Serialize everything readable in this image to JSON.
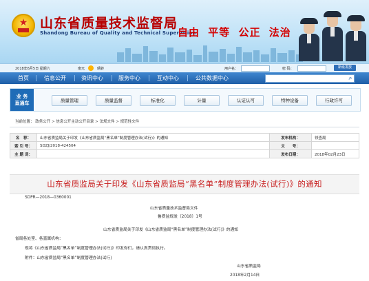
{
  "header": {
    "title": "山东省质量技术监督局",
    "subtitle": "Shandong Bureau of Quality and Technical Supervision",
    "slogan": [
      "自由",
      "平等",
      "公正",
      "法治"
    ]
  },
  "login_bar": {
    "date": "2018年6月5日 星期六",
    "weather_city": "南元",
    "weather": "晴转",
    "username_label": "用户名：",
    "password_label": "密 码：",
    "register_label": "新级发放"
  },
  "nav": {
    "items": [
      "首页",
      "信息公开",
      "资讯中心",
      "服务中心",
      "互动中心",
      "公共数据中心"
    ],
    "search_placeholder": ""
  },
  "business": {
    "label": "业务直通车",
    "buttons": [
      "质量管理",
      "质量监督",
      "标准化",
      "计量",
      "认证认可",
      "特种设备",
      "行政许可"
    ]
  },
  "breadcrumb": "当前位置：  政务公开  >  信息公开主动公开目录  >  法规文件  >  规范性文件",
  "meta": {
    "name_label": "名　称：",
    "name_value": "山东省质监局关于印发《山东省质监局“黑名单”制度管理办法(试行)》的通知",
    "issuer_label": "发布机构：",
    "issuer_value": "领查局",
    "index_label": "索 引 号：",
    "index_value": "SDZJ/2018-424504",
    "docno_label": "文　　号：",
    "docno_value": "",
    "subject_label": "主 题 词：",
    "subject_value": "",
    "date_label": "发布日期：",
    "date_value": "2018年02月23日"
  },
  "document": {
    "title": "山东省质监局关于印发《山东省质监局“黑名单”制度管理办法(试行)》的通知",
    "sdpr": "SDPR—2018—0360001",
    "issuer_line": "山东省质量技术监督局文件",
    "doc_number": "鲁质监规发〔2018〕1号",
    "sub_title": "山东省质监局关于印发《山东省质监局“黑名单”制度管理办法(试行)》的通知",
    "salutation": "省局各处室、各直属机构：",
    "paragraph": "现将《山东省质监局“黑名单”制度管理办法(试行)》印发你们，请认真贯彻执行。",
    "attachment": "附件：山东省质监局“黑名单”制度管理办法(试行)",
    "signature": "山东省质监局",
    "sign_date": "2018年2月14日"
  }
}
